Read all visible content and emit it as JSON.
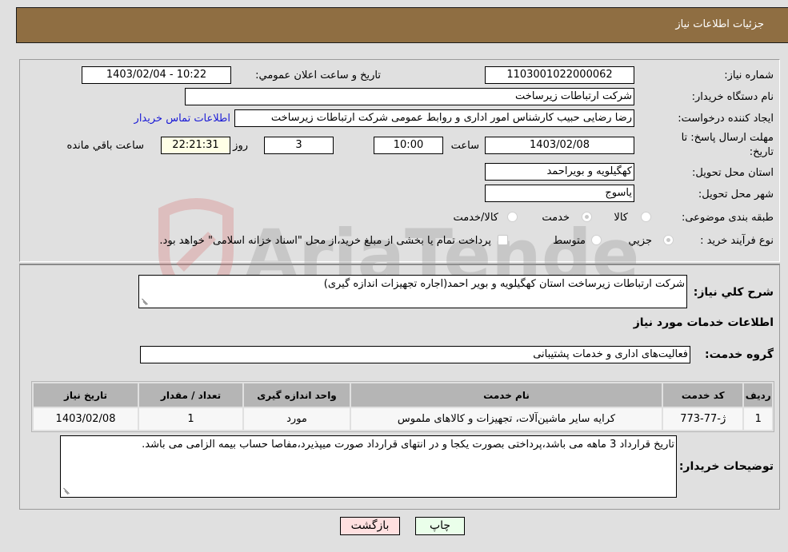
{
  "header": {
    "title": "جزئیات اطلاعات نیاز"
  },
  "form": {
    "need_number": {
      "label": "شماره نیاز:",
      "value": "1103001022000062"
    },
    "announce_datetime": {
      "label": "تاریخ و ساعت اعلان عمومي:",
      "value": "1403/02/04 - 10:22"
    },
    "buyer_org": {
      "label": "نام دستگاه خریدار:",
      "value": "شرکت ارتباطات زیرساخت"
    },
    "requester": {
      "label": "ایجاد کننده درخواست:",
      "value": "رضا رضایی حبیب کارشناس امور اداری و روابط عمومی شرکت ارتباطات زیرساخت",
      "contact_link": "اطلاعات تماس خریدار"
    },
    "deadline": {
      "label_line1": "مهلت ارسال پاسخ: تا",
      "label_line2": "تاریخ:",
      "date": "1403/02/08",
      "time_label": "ساعت",
      "time": "10:00",
      "days": "3",
      "days_label": "روز و",
      "remaining": "22:21:31",
      "remaining_label": "ساعت باقي مانده"
    },
    "province": {
      "label": "استان محل تحویل:",
      "value": "کهگیلویه و بویراحمد"
    },
    "city": {
      "label": "شهر محل تحویل:",
      "value": "یاسوج"
    },
    "category": {
      "label": "طبقه بندی موضوعی:",
      "options": [
        "کالا",
        "خدمت",
        "کالا/خدمت"
      ],
      "selected": "خدمت"
    },
    "purchase_type": {
      "label": "نوع فرآیند خرید :",
      "options": [
        "جزيي",
        "متوسط"
      ],
      "selected": "جزيي",
      "treasury_note": "پرداخت تمام یا بخشی از مبلغ خرید،از محل \"اسناد خزانه اسلامی\" خواهد بود."
    }
  },
  "description": {
    "label": "شرح كلي نياز:",
    "value": "شرکت ارتباطات زیرساخت استان کهگیلویه و بویر احمد(اجاره تجهیزات اندازه گیری)"
  },
  "services_section": {
    "title": "اطلاعات خدمات مورد نیاز",
    "group_label": "گروه خدمت:",
    "group_value": "فعالیت‌های اداری و خدمات پشتیبانی"
  },
  "table": {
    "headers": [
      "ردیف",
      "کد خدمت",
      "نام خدمت",
      "واحد اندازه گیری",
      "تعداد / مقدار",
      "تاریخ نیاز"
    ],
    "rows": [
      [
        "1",
        "ژ-77-773",
        "کرایه سایر ماشین‌آلات، تجهیزات و کالاهای ملموس",
        "مورد",
        "1",
        "1403/02/08"
      ]
    ]
  },
  "buyer_notes": {
    "label": "توضیحات خریدار:",
    "value": "تاریخ قرارداد 3 ماهه می باشد،پرداختی بصورت یکجا و در انتهای قرارداد صورت میپذیرد،مفاصا حساب بیمه الزامی می باشد."
  },
  "buttons": {
    "print": "چاپ",
    "back": "بازگشت"
  },
  "watermark": {
    "text": "AriaTender.neT"
  },
  "colors": {
    "header_bg": "#8f6e42",
    "link": "#1a1ad6",
    "print_bg": "#eaffea",
    "back_bg": "#ffe0e0",
    "remaining_bg": "#ffffe6"
  }
}
